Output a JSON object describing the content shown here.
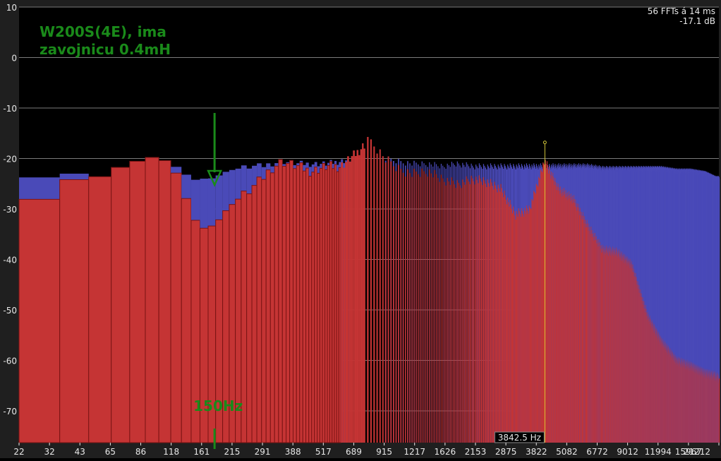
{
  "chart_data": {
    "type": "bar",
    "subtype": "fft-spectrum",
    "annotation": {
      "title_line1": "W200S(4E), ima",
      "title_line2": "zavojnicu 0.4mH",
      "marker_label": "150Hz",
      "marker_freq": 150
    },
    "info": {
      "fft_info": "56 FFTs á 14 ms",
      "level": "-17.1 dB"
    },
    "cursor": {
      "freq": 3842.5,
      "label": "3842.5 Hz",
      "level": -17.1
    },
    "y_ticks": [
      10,
      0,
      -10,
      -20,
      -30,
      -40,
      -50,
      -60,
      -70
    ],
    "ylim": [
      -76.3,
      10
    ],
    "x_ticks": [
      "22",
      "32",
      "43",
      "65",
      "86",
      "118",
      "161",
      "215",
      "291",
      "388",
      "517",
      "689",
      "915",
      "1217",
      "1626",
      "2153",
      "2875",
      "3822",
      "5082",
      "6772",
      "9012",
      "11994",
      "15967",
      "21212"
    ],
    "xlim": [
      22,
      21212
    ],
    "x_scale": "log",
    "grid": true,
    "colors": {
      "red_series": "#c53434",
      "red_edge": "#7a1414",
      "blue_series": "#4a4ab8",
      "grid": "#7a7a7a",
      "axis_text": "#e8e8e8",
      "annotation": "#1a8a1a",
      "cursor": "#d4c83a",
      "panel_bg": "#1f1f1f"
    },
    "series": [
      {
        "color_key": "blue_series",
        "points": [
          [
            22,
            -24.5
          ],
          [
            27,
            -23.8
          ],
          [
            36,
            -22.8
          ],
          [
            48,
            -23.8
          ],
          [
            65,
            -21
          ],
          [
            86,
            -19.5
          ],
          [
            100,
            -21.5
          ],
          [
            110,
            -22
          ],
          [
            118,
            -24.5
          ],
          [
            130,
            -24
          ],
          [
            145,
            -24
          ],
          [
            155,
            -23.5
          ],
          [
            170,
            -22.5
          ],
          [
            190,
            -22
          ],
          [
            215,
            -21.5
          ],
          [
            240,
            -21.5
          ],
          [
            260,
            -21
          ],
          [
            291,
            -20.5
          ],
          [
            340,
            -21
          ],
          [
            388,
            -21
          ],
          [
            450,
            -21
          ],
          [
            517,
            -20.5
          ],
          [
            600,
            -20
          ],
          [
            689,
            -19.5
          ],
          [
            800,
            -20
          ],
          [
            915,
            -20.5
          ],
          [
            1050,
            -21
          ],
          [
            1217,
            -21
          ],
          [
            1400,
            -21.5
          ],
          [
            1626,
            -21
          ],
          [
            1900,
            -21.5
          ],
          [
            2153,
            -21.5
          ],
          [
            2500,
            -21.5
          ],
          [
            2875,
            -21.5
          ],
          [
            3300,
            -21.5
          ],
          [
            3822,
            -21.5
          ],
          [
            4400,
            -21.5
          ],
          [
            5082,
            -21.5
          ],
          [
            5800,
            -21.5
          ],
          [
            6772,
            -22
          ],
          [
            7800,
            -22
          ],
          [
            9012,
            -22
          ],
          [
            10500,
            -22
          ],
          [
            11994,
            -22
          ],
          [
            14000,
            -22.5
          ],
          [
            15967,
            -22.5
          ],
          [
            18500,
            -23
          ],
          [
            20500,
            -24
          ],
          [
            21212,
            -24
          ]
        ]
      },
      {
        "color_key": "red_series",
        "points": [
          [
            22,
            -39.5
          ],
          [
            27,
            -28.3
          ],
          [
            36,
            -24.3
          ],
          [
            48,
            -23.8
          ],
          [
            65,
            -21
          ],
          [
            86,
            -19.5
          ],
          [
            100,
            -21.5
          ],
          [
            110,
            -26
          ],
          [
            118,
            -30
          ],
          [
            130,
            -34
          ],
          [
            145,
            -33.5
          ],
          [
            155,
            -32.5
          ],
          [
            170,
            -30
          ],
          [
            190,
            -28
          ],
          [
            215,
            -26
          ],
          [
            240,
            -24
          ],
          [
            260,
            -22
          ],
          [
            291,
            -20.5
          ],
          [
            340,
            -21.5
          ],
          [
            388,
            -22.5
          ],
          [
            450,
            -21.5
          ],
          [
            517,
            -21.5
          ],
          [
            600,
            -19
          ],
          [
            689,
            -16
          ],
          [
            800,
            -20
          ],
          [
            915,
            -22
          ],
          [
            1050,
            -23
          ],
          [
            1217,
            -22.5
          ],
          [
            1400,
            -24
          ],
          [
            1626,
            -25
          ],
          [
            1900,
            -24
          ],
          [
            2153,
            -24.5
          ],
          [
            2500,
            -26
          ],
          [
            2875,
            -31
          ],
          [
            3300,
            -30
          ],
          [
            3822,
            -20.5
          ],
          [
            4400,
            -26
          ],
          [
            5082,
            -28
          ],
          [
            5800,
            -33
          ],
          [
            6772,
            -38
          ],
          [
            7800,
            -38.5
          ],
          [
            9012,
            -41
          ],
          [
            10500,
            -51
          ],
          [
            11994,
            -56
          ],
          [
            14000,
            -60
          ],
          [
            15967,
            -61
          ],
          [
            18500,
            -62.5
          ],
          [
            20500,
            -63
          ],
          [
            21212,
            -63.5
          ]
        ]
      }
    ]
  }
}
